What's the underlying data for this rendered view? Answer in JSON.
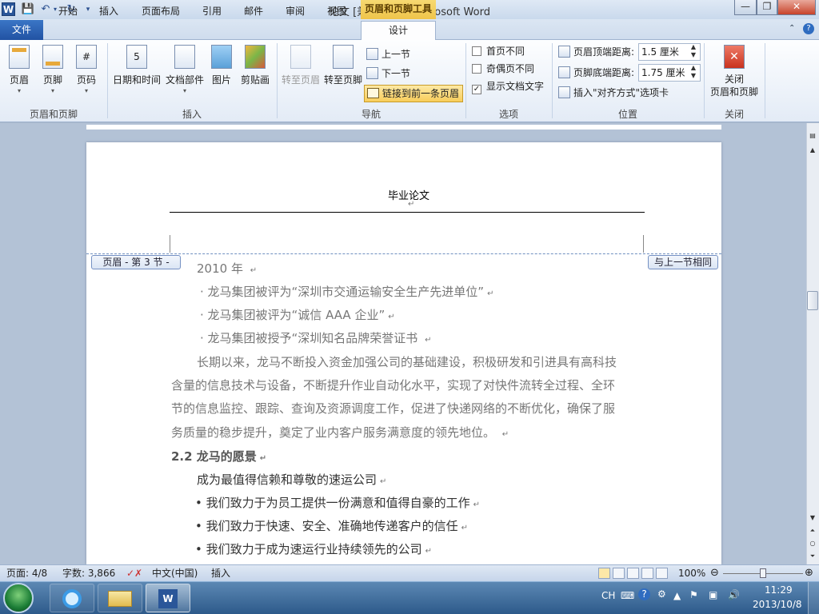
{
  "window": {
    "title": "论文 [兼容模式] - Microsoft Word",
    "logo": "W",
    "contextual_tab_group": "页眉和页脚工具",
    "controls": {
      "minimize": "—",
      "maximize": "❐",
      "close": "✕"
    }
  },
  "quick_access": [
    "save-icon",
    "undo-icon",
    "redo-icon",
    "customize-icon"
  ],
  "tabs": [
    "文件",
    "开始",
    "插入",
    "页面布局",
    "引用",
    "邮件",
    "审阅",
    "视图",
    "设计"
  ],
  "active_tab": "设计",
  "ribbon": {
    "groups": [
      {
        "label": "页眉和页脚",
        "buttons": [
          "页眉",
          "页脚",
          "页码"
        ]
      },
      {
        "label": "插入",
        "buttons": [
          "日期和时间",
          "文档部件",
          "图片",
          "剪贴画"
        ]
      },
      {
        "label": "导航",
        "buttons": [
          "转至页眉",
          "转至页脚"
        ],
        "small": [
          "上一节",
          "下一节",
          "链接到前一条页眉"
        ]
      },
      {
        "label": "选项",
        "checkboxes": [
          {
            "label": "首页不同",
            "checked": false
          },
          {
            "label": "奇偶页不同",
            "checked": false
          },
          {
            "label": "显示文档文字",
            "checked": true
          }
        ]
      },
      {
        "label": "位置",
        "fields": [
          {
            "label": "页眉顶端距离:",
            "value": "1.5 厘米"
          },
          {
            "label": "页脚底端距离:",
            "value": "1.75 厘米"
          }
        ],
        "link": "插入\"对齐方式\"选项卡"
      },
      {
        "label": "关闭",
        "buttons": [
          "关闭\n页眉和页脚"
        ]
      }
    ],
    "icons": {
      "close_color": "#d23a2a",
      "link_highlight": "#f8cd5b"
    }
  },
  "document": {
    "header_text": "毕业论文",
    "header_tag": "页眉 - 第 3 节 -",
    "same_as_previous": "与上一节相同",
    "lines": [
      "2010 年 ",
      "· 龙马集团被评为“深圳市交通运输安全生产先进单位”",
      "· 龙马集团被评为“诚信 AAA 企业”",
      "· 龙马集团被授予“深圳知名品牌荣誉证书 ",
      "长期以来，龙马不断投入资金加强公司的基础建设，积极研发和引进具有高科技",
      "含量的信息技术与设备，不断提升作业自动化水平，实现了对快件流转全过程、全环",
      "节的信息监控、跟踪、查询及资源调度工作，促进了快递网络的不断优化，确保了服",
      "务质量的稳步提升，奠定了业内客户服务满意度的领先地位。 "
    ],
    "heading": "2.2  龙马的愿景",
    "vision_intro": "成为最值得信赖和尊敬的速运公司",
    "bullets": [
      "•  我们致力于为员工提供一份满意和值得自豪的工作",
      "•  我们致力于快速、安全、准确地传递客户的信任",
      "•  我们致力于成为速运行业持续领先的公司"
    ],
    "para_mark": "↵"
  },
  "status": {
    "page": "页面: 4/8",
    "words": "字数: 3,866",
    "language": "中文(中国)",
    "mode": "插入",
    "zoom": "100%",
    "zoom_level": 0.5
  },
  "taskbar": {
    "apps": [
      "ie-icon",
      "explorer-icon",
      "word-icon"
    ],
    "lang": "CH",
    "time": "11:29",
    "date": "2013/10/8"
  }
}
